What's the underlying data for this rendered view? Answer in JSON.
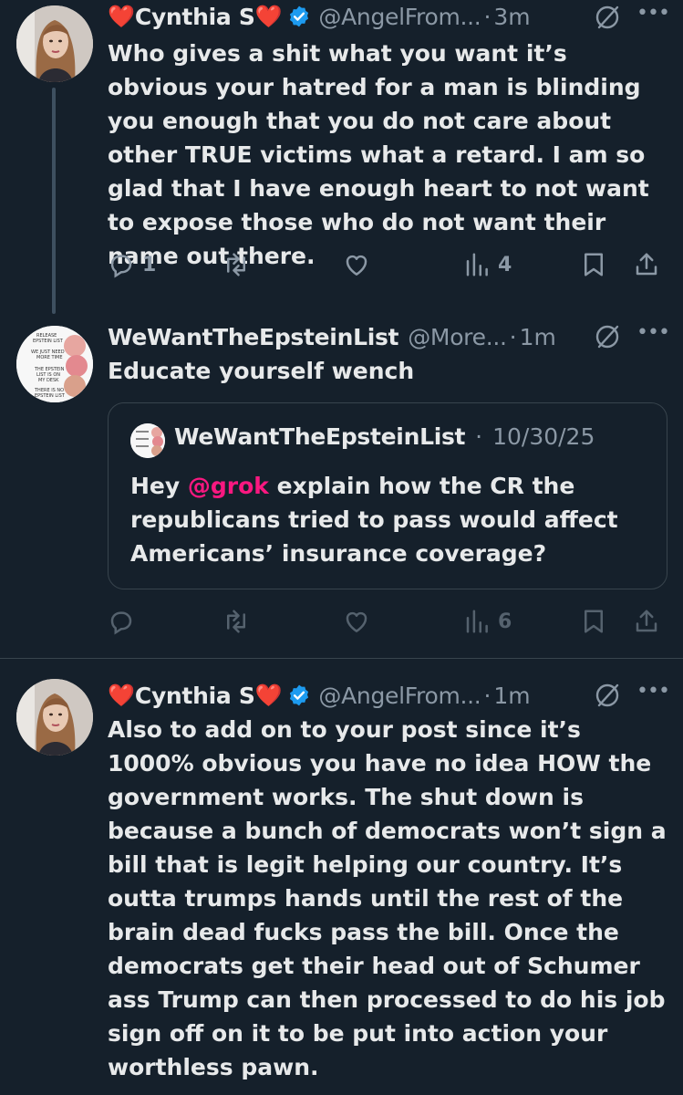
{
  "tweets": [
    {
      "name": "Cynthia S",
      "handle": "@AngelFrom...",
      "time": "3m",
      "text": "Who gives a shit what you want it’s obvious your hatred for a man is blinding you enough that you do not care about other TRUE victims what a retard. I am so glad that I have enough heart to not want to expose those who do not want their name out there.",
      "replies": "1",
      "reposts": "",
      "likes": "",
      "views": "4"
    },
    {
      "name": "WeWantTheEpsteinList",
      "handle": "@More...",
      "time": "1m",
      "text": "Educate yourself wench",
      "replies": "",
      "reposts": "",
      "likes": "",
      "views": "6",
      "avatar_text": [
        "RELEASE",
        "EPSTEIN LIST",
        "WE JUST NEED",
        "MORE TIME",
        "THE EPSTEIN",
        "LIST IS ON",
        "MY DESK",
        "THERE IS NO",
        "EPSTEIN LIST"
      ],
      "quote": {
        "name": "WeWantTheEpsteinList",
        "date": "10/30/25",
        "text_before": "Hey ",
        "mention": "@grok",
        "text_after": " explain how the CR the republicans tried to pass would affect Americans’ insurance coverage?"
      }
    },
    {
      "name": "Cynthia S",
      "handle": "@AngelFrom...",
      "time": "1m",
      "text": "Also to add on to your post since it’s 1000% obvious you have no idea HOW the government works. The shut down is because a bunch of democrats won’t sign a bill that is legit helping our country.  It’s outta trumps hands until the rest of the brain dead fucks pass the bill. Once the democrats get their head out of Schumer ass Trump can then processed to do his job sign off on it to be put into action your worthless pawn."
    }
  ],
  "separator": "·",
  "heart_glyph": "❤️",
  "icons": [
    "reply-icon",
    "repost-icon",
    "like-icon",
    "views-icon",
    "bookmark-icon",
    "share-icon",
    "grok-icon",
    "more-icon",
    "verified-icon"
  ],
  "colors": {
    "background": "#15202b",
    "text": "#e7e9ea",
    "muted": "#8b98a5",
    "verified": "#1d9bf0",
    "heart": "#e0243a",
    "mention": "#f91880",
    "border": "#38444d"
  }
}
